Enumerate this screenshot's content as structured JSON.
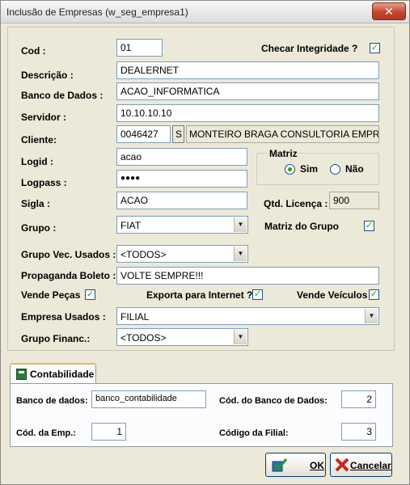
{
  "window": {
    "title": "Inclusão de Empresas (w_seg_empresa1)",
    "close_glyph": "✕"
  },
  "form": {
    "cod": {
      "label": "Cod :",
      "value": "01"
    },
    "checar_integridade": {
      "label": "Checar Integridade  ?",
      "checked": true
    },
    "descricao": {
      "label": "Descrição :",
      "value": "DEALERNET"
    },
    "banco_dados": {
      "label": "Banco de Dados :",
      "value": "ACAO_INFORMATICA"
    },
    "servidor": {
      "label": "Servidor :",
      "value": "10.10.10.10"
    },
    "cliente": {
      "label": "Cliente:",
      "code": "0046427",
      "lookup_glyph": "S",
      "name": "MONTEIRO BRAGA CONSULTORIA EMPRE"
    },
    "logid": {
      "label": "Logid :",
      "value": "acao"
    },
    "logpass": {
      "label": "Logpass :",
      "value": "●●●●"
    },
    "matriz": {
      "label": "Matriz",
      "sim": "Sim",
      "nao": "Não",
      "selected": "Sim"
    },
    "sigla": {
      "label": "Sigla :",
      "value": "ACAO"
    },
    "qtd_licenca": {
      "label": "Qtd. Licença :",
      "value": "900"
    },
    "grupo": {
      "label": "Grupo :",
      "value": "FIAT"
    },
    "matriz_grupo": {
      "label": "Matriz do Grupo",
      "checked": true
    },
    "grupo_vec_usados": {
      "label": "Grupo Vec. Usados :",
      "value": "<TODOS>"
    },
    "propaganda_boleto": {
      "label": "Propaganda Boleto :",
      "value": "VOLTE SEMPRE!!!"
    },
    "vende_pecas": {
      "label": "Vende Peças",
      "checked": true
    },
    "exporta_internet": {
      "label": "Exporta para Internet ?",
      "checked": true
    },
    "vende_veiculos": {
      "label": "Vende Veículos",
      "checked": true
    },
    "empresa_usados": {
      "label": "Empresa Usados :",
      "value": "FILIAL"
    },
    "grupo_financ": {
      "label": "Grupo Financ.:",
      "value": "<TODOS>"
    }
  },
  "tabs": {
    "contabilidade": {
      "label": "Contabilidade",
      "banco_dados_label": "Banco de dados:",
      "banco_dados_value": "banco_contabilidade",
      "cod_banco_label": "Cód. do Banco de Dados:",
      "cod_banco_value": "2",
      "cod_emp_label": "Cód. da Emp.:",
      "cod_emp_value": "1",
      "cod_filial_label": "Código da Filial:",
      "cod_filial_value": "3"
    }
  },
  "buttons": {
    "ok": "OK",
    "cancelar": "Cancelar"
  },
  "check_glyph": "✓"
}
